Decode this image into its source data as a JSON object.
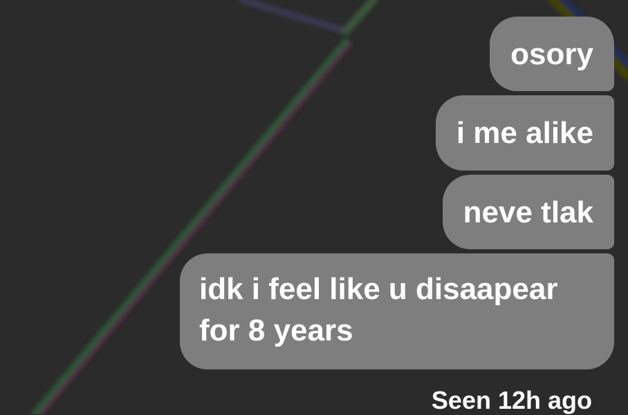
{
  "messages": [
    {
      "text": "osory"
    },
    {
      "text": "i me alike"
    },
    {
      "text": "neve tlak"
    },
    {
      "text": "idk i feel like u disaapear for 8 years"
    }
  ],
  "status": {
    "seen": "Seen 12h ago"
  },
  "colors": {
    "background": "#2b2b2b",
    "bubble": "#7e7e7e",
    "text": "#ffffff"
  }
}
